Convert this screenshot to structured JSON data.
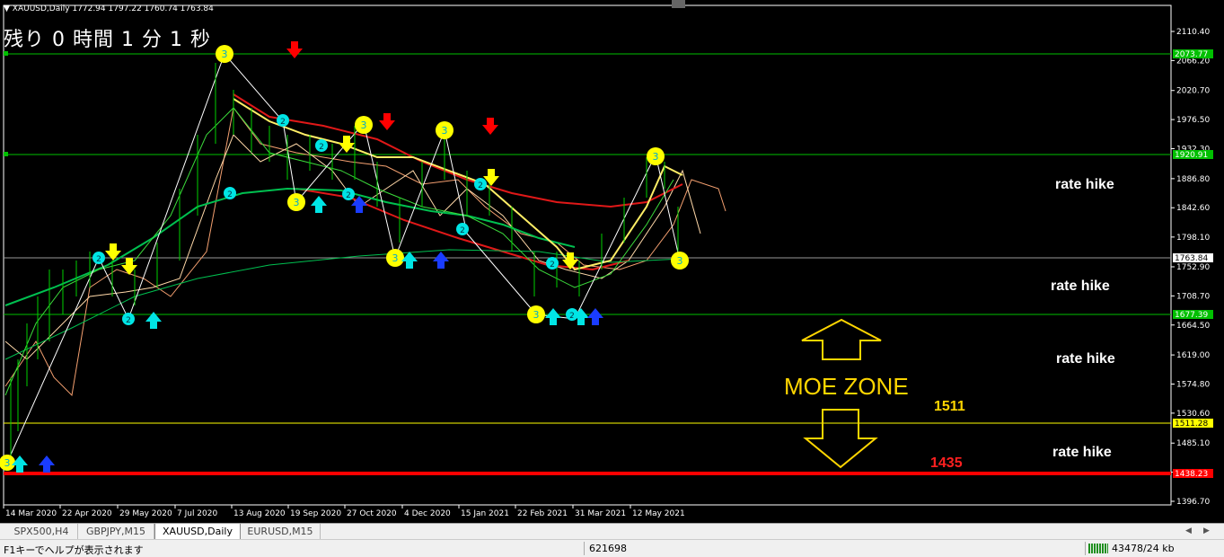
{
  "symbol_info": "▼ XAUUSD,Daily  1772.94 1797.22 1760.74 1763.84",
  "countdown": "残り 0 時間 1 分 1 秒",
  "price_axis": [
    "2110.40",
    "2066.20",
    "2020.70",
    "1976.50",
    "1932.30",
    "1886.80",
    "1842.60",
    "1798.10",
    "1752.90",
    "1708.70",
    "1664.50",
    "1619.00",
    "1574.80",
    "1530.60",
    "1485.10",
    "1440.90",
    "1396.70"
  ],
  "price_tags": [
    {
      "label": "2073.77",
      "color": "#00c000"
    },
    {
      "label": "1920.91",
      "color": "#00c000"
    },
    {
      "label": "1763.84",
      "color": "#ffffff"
    },
    {
      "label": "1677.39",
      "color": "#00c000"
    },
    {
      "label": "1511.28",
      "color": "#ffff00"
    },
    {
      "label": "1438.23",
      "color": "#ff0000"
    }
  ],
  "date_axis": [
    "14 Mar 2020",
    "22 Apr 2020",
    "29 May 2020",
    "7 Jul 2020",
    "13 Aug 2020",
    "19 Sep 2020",
    "27 Oct 2020",
    "4 Dec 2020",
    "15 Jan 2021",
    "22 Feb 2021",
    "31 Mar 2021",
    "12 May 2021"
  ],
  "notes": [
    "rate hike",
    "rate hike",
    "rate hike",
    "rate hike"
  ],
  "moe_zone": "MOE ZONE",
  "level_1511": "1511",
  "level_1435": "1435",
  "colors": {
    "up_arrow": "#00e5e5",
    "down_arrow": "#ff0000",
    "zone": "#ffd600",
    "green_line": "#00c000",
    "red_line": "#ff0000",
    "yellow_line": "#ffff00"
  },
  "tabs": [
    "SPX500,H4",
    "GBPJPY,M15",
    "XAUUSD,Daily",
    "EURUSD,M15"
  ],
  "status": {
    "help": "F1キーでヘルプが表示されます",
    "number": "621698",
    "traffic": "43478/24 kb"
  }
}
